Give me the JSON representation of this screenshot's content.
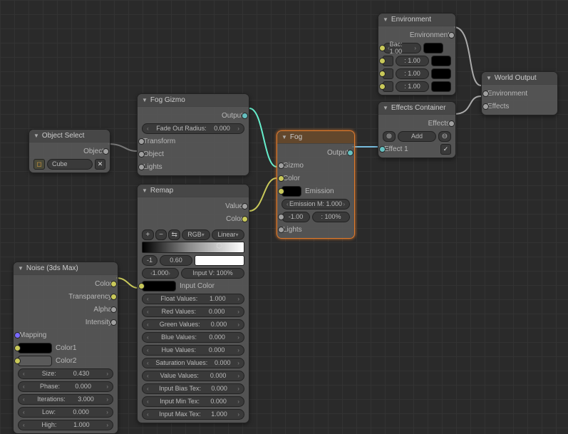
{
  "nodes": {
    "object_select": {
      "title": "Object Select",
      "out_object": "Object",
      "item": "Cube"
    },
    "fog_gizmo": {
      "title": "Fog Gizmo",
      "out": "Output",
      "fade_label": "Fade Out Radius:",
      "fade_value": "0.000",
      "in_transform": "Transform",
      "in_object": "Object",
      "in_lights": "Lights"
    },
    "remap": {
      "title": "Remap",
      "out_value": "Value",
      "out_color": "Color",
      "mode_rgb": "RGB",
      "mode_linear": "Linear",
      "marker_neg": "-1",
      "marker_val": "0.60",
      "mul_label": "1.000",
      "input_v": "Input V: 100%",
      "input_color": "Input Color",
      "rows": [
        {
          "label": "Float Values:",
          "value": "1.000"
        },
        {
          "label": "Red Values:",
          "value": "0.000"
        },
        {
          "label": "Green Values:",
          "value": "0.000"
        },
        {
          "label": "Blue Values:",
          "value": "0.000"
        },
        {
          "label": "Hue Values:",
          "value": "0.000"
        },
        {
          "label": "Saturation Values:",
          "value": "0.000"
        },
        {
          "label": "Value Values:",
          "value": "0.000"
        },
        {
          "label": "Input Bias Tex:",
          "value": "0.000"
        },
        {
          "label": "Input Min Tex:",
          "value": "0.000"
        },
        {
          "label": "Input Max Tex:",
          "value": "1.000"
        }
      ]
    },
    "noise": {
      "title": "Noise (3ds Max)",
      "out_color": "Color",
      "out_transparency": "Transparency",
      "out_alpha": "Alpha",
      "out_intensity": "Intensity",
      "in_mapping": "Mapping",
      "in_color1": "Color1",
      "in_color2": "Color2",
      "rows": [
        {
          "label": "Size:",
          "value": "0.430"
        },
        {
          "label": "Phase:",
          "value": "0.000"
        },
        {
          "label": "Iterations:",
          "value": "3.000"
        },
        {
          "label": "Low:",
          "value": "0.000"
        },
        {
          "label": "High:",
          "value": "1.000"
        }
      ]
    },
    "fog": {
      "title": "Fog",
      "out": "Output",
      "in_gizmo": "Gizmo",
      "in_color": "Color",
      "emission": "Emission",
      "emission_m_label": "Emission M:",
      "emission_m_value": "1.000",
      "height_val": "-1.00",
      "height_pct": ": 100%",
      "in_lights": "Lights"
    },
    "environment": {
      "title": "Environment",
      "out": "Environment",
      "bac_label": "Bac:",
      "bac_value": "1.00",
      "ref_value": ": 1.00",
      "refr_value": ": 1.00",
      "sec_value": ": 1.00"
    },
    "effects": {
      "title": "Effects Container",
      "out": "Effects",
      "add": "Add",
      "effect1": "Effect 1"
    },
    "world": {
      "title": "World Output",
      "in_env": "Environment",
      "in_eff": "Effects"
    }
  }
}
